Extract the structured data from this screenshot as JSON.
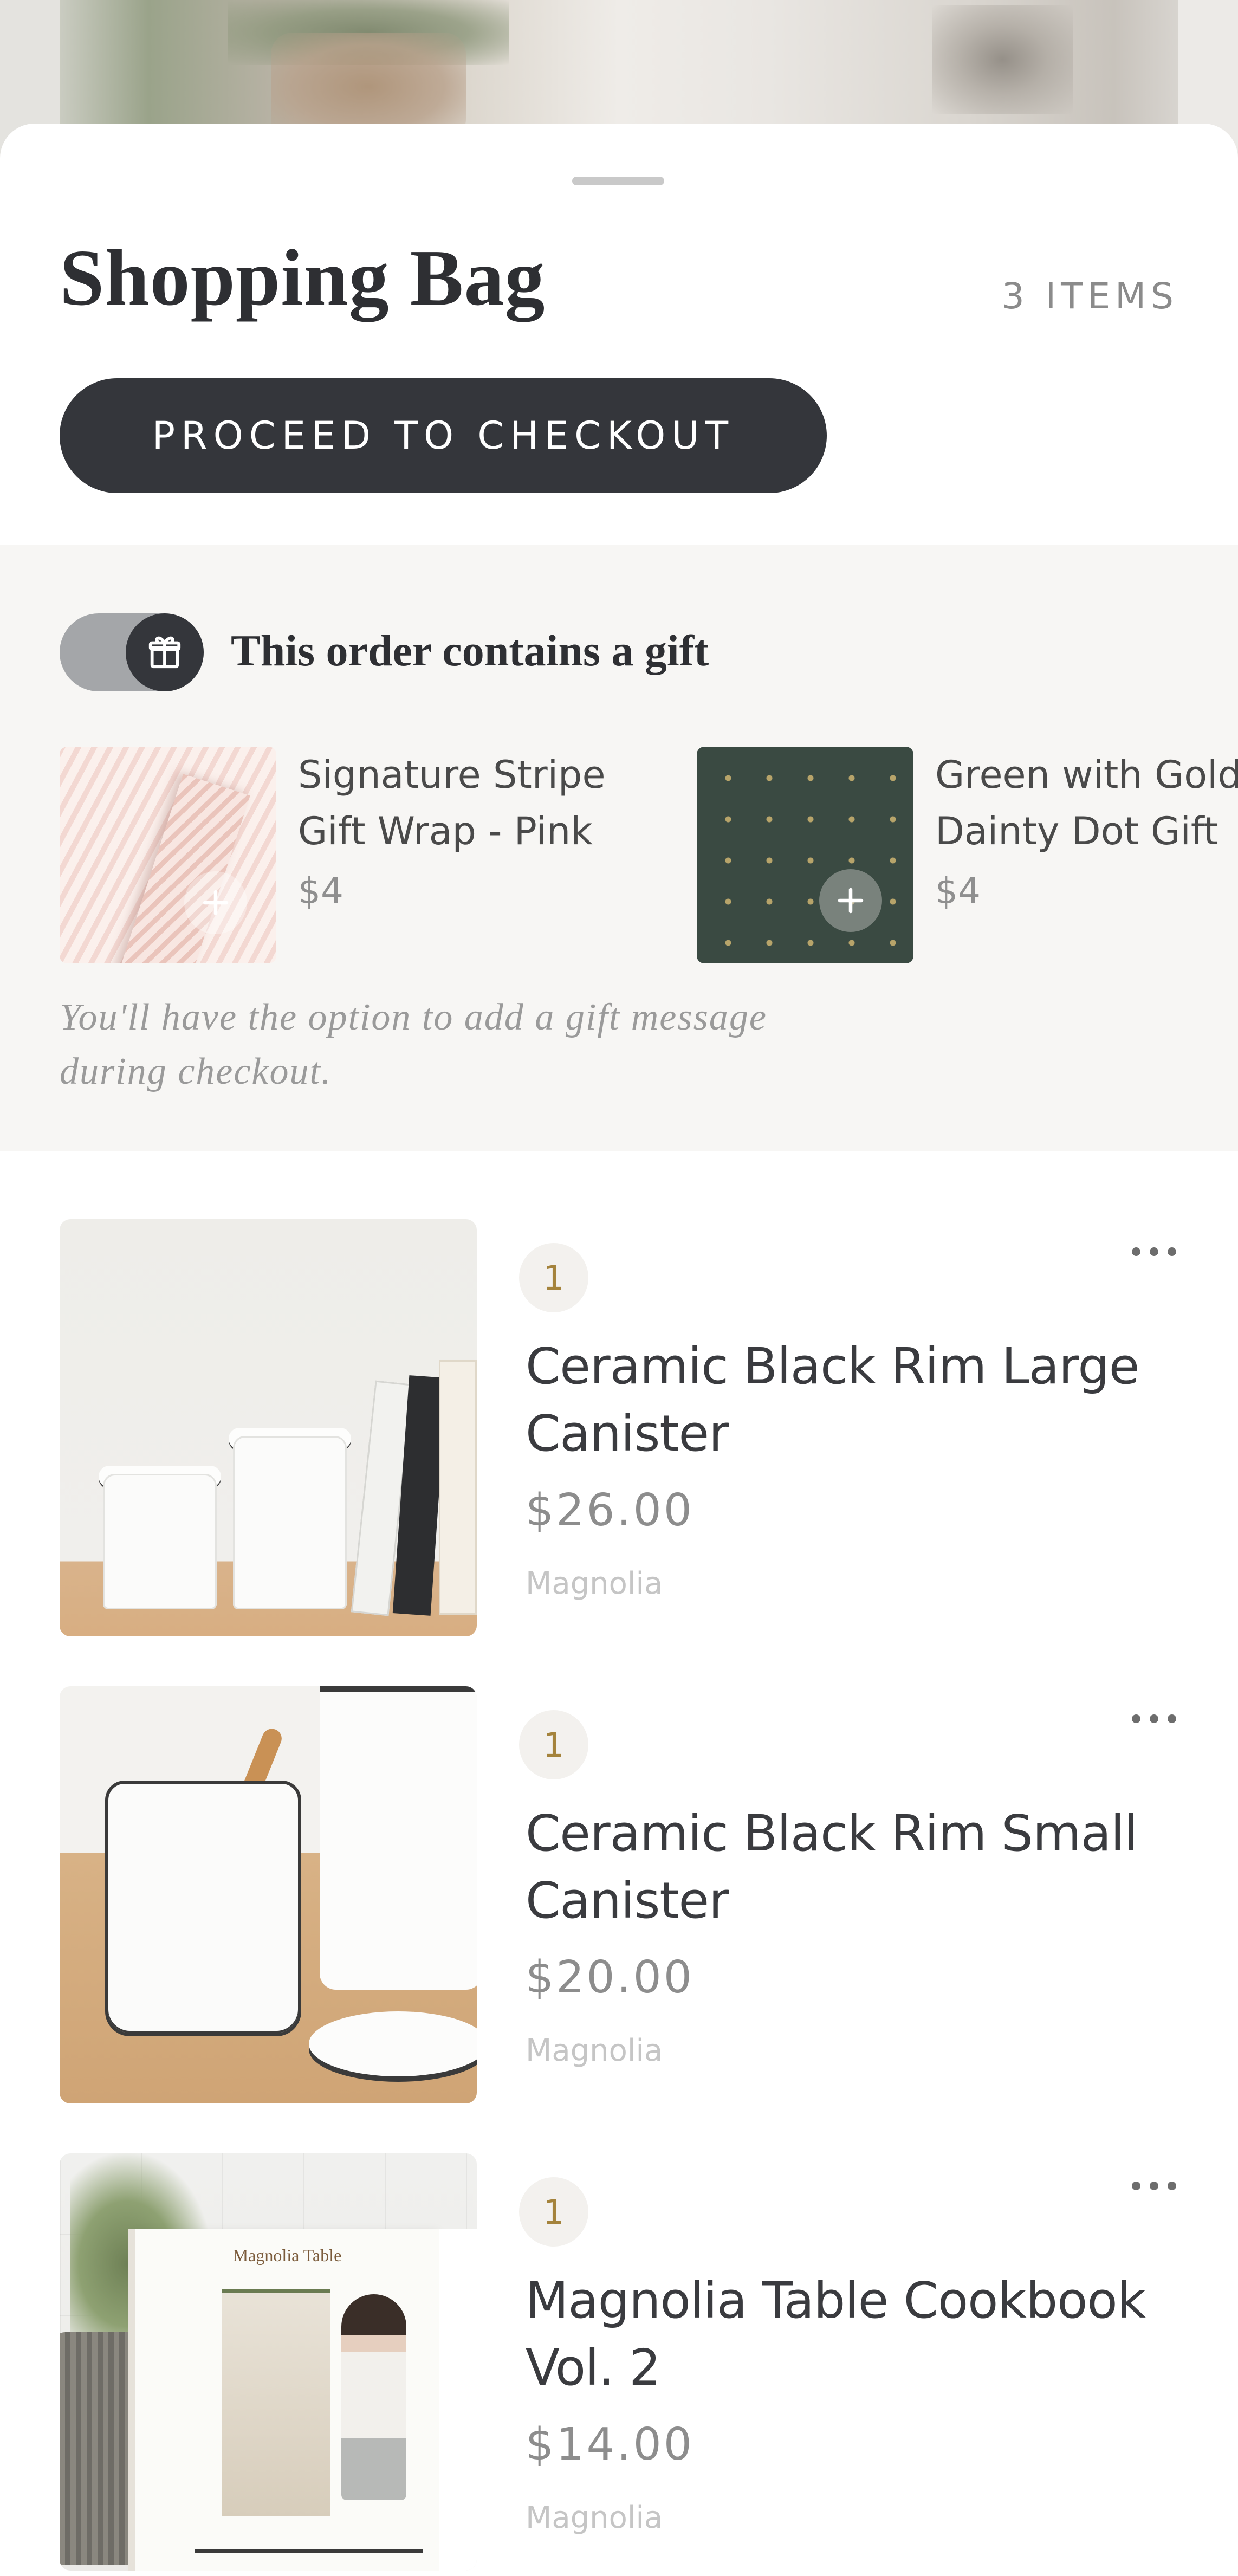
{
  "bag": {
    "title": "Shopping Bag",
    "item_count": "3 ITEMS",
    "checkout_label": "PROCEED TO CHECKOUT"
  },
  "gift": {
    "toggle_label": "This order contains a gift",
    "toggle_on": true,
    "wraps": [
      {
        "name_line1": "Signature Stripe",
        "name_line2": "Gift Wrap - Pink",
        "price": "$4"
      },
      {
        "name_line1": "Green with Gold",
        "name_line2": "Dainty Dot Gift",
        "price": "$4"
      }
    ],
    "note_line1": "You'll have the option to add a gift message",
    "note_line2": "during checkout."
  },
  "items": [
    {
      "qty": "1",
      "name": "Ceramic Black Rim Large Canister",
      "price": "$26.00",
      "brand": "Magnolia"
    },
    {
      "qty": "1",
      "name": "Ceramic Black Rim Small Canister",
      "price": "$20.00",
      "brand": "Magnolia"
    },
    {
      "qty": "1",
      "name": "Magnolia Table Cookbook Vol. 2",
      "price": "$14.00",
      "brand": "Magnolia",
      "cover_title": "Magnolia Table"
    }
  ],
  "icons": {
    "toggle": "gift-icon",
    "add": "plus-icon",
    "more": "more-horizontal-icon"
  },
  "colors": {
    "accent_dark": "#34363b",
    "qty_text": "#a4833c",
    "gift_panel_bg": "#f7f6f4"
  }
}
